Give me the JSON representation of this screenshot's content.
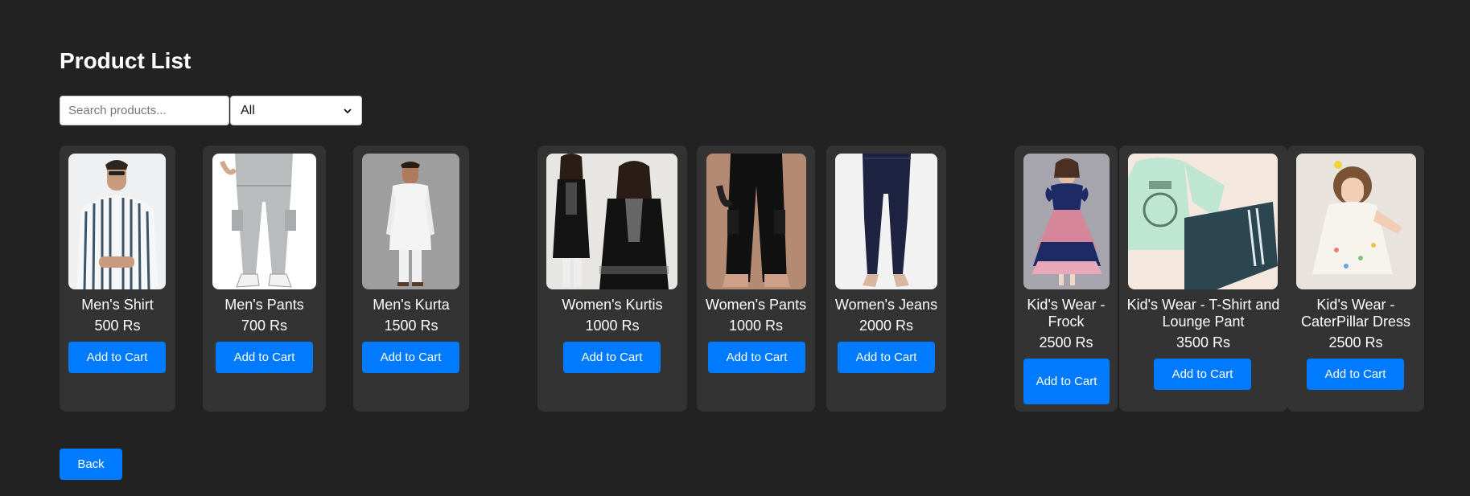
{
  "page": {
    "title": "Product List"
  },
  "search": {
    "placeholder": "Search products...",
    "value": ""
  },
  "filter": {
    "selected": "All"
  },
  "add_label": "Add to Cart",
  "products": [
    {
      "name": "Men's Shirt",
      "price": "500 Rs"
    },
    {
      "name": "Men's Pants",
      "price": "700 Rs"
    },
    {
      "name": "Men's Kurta",
      "price": "1500 Rs"
    },
    {
      "name": "Women's Kurtis",
      "price": "1000 Rs"
    },
    {
      "name": "Women's Pants",
      "price": "1000 Rs"
    },
    {
      "name": "Women's Jeans",
      "price": "2000 Rs"
    },
    {
      "name": "Kid's Wear - Frock",
      "price": "2500 Rs"
    },
    {
      "name": "Kid's Wear - T-Shirt and Lounge Pant",
      "price": "3500 Rs"
    },
    {
      "name": "Kid's Wear - CaterPillar Dress",
      "price": "2500 Rs"
    }
  ],
  "back_label": "Back",
  "colors": {
    "background": "#222222",
    "card": "#333333",
    "accent": "#007bff"
  }
}
